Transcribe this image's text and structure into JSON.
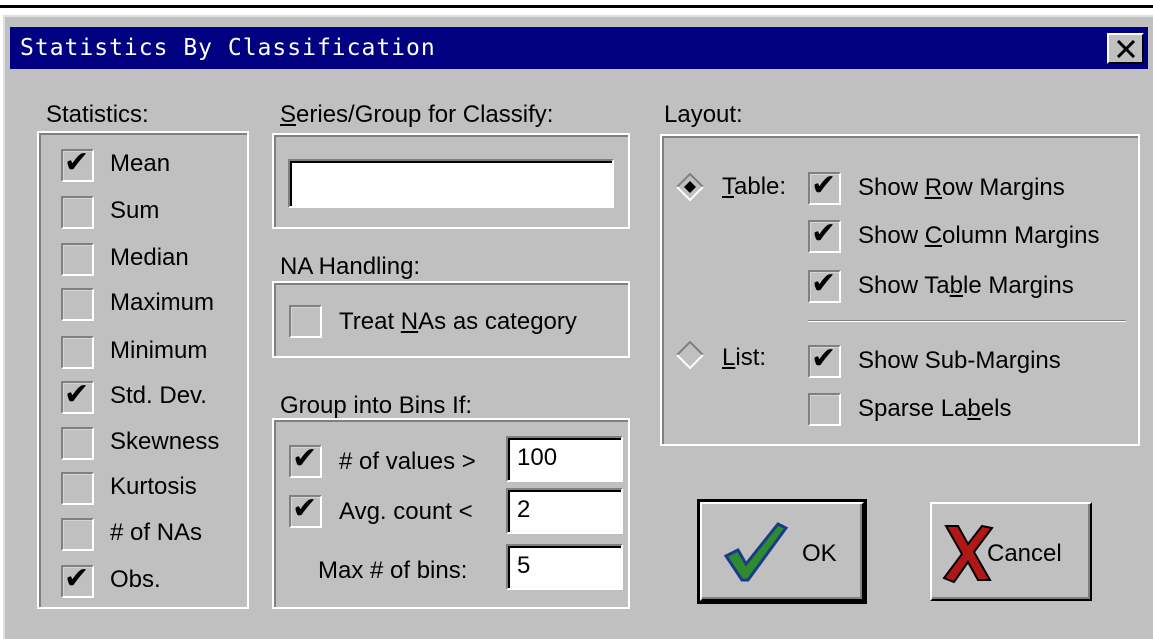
{
  "window": {
    "title": "Statistics By Classification"
  },
  "statistics": {
    "label": "Statistics:",
    "items": [
      {
        "label": "Mean",
        "checked": true
      },
      {
        "label": "Sum",
        "checked": false
      },
      {
        "label": "Median",
        "checked": false
      },
      {
        "label": "Maximum",
        "checked": false
      },
      {
        "label": "Minimum",
        "checked": false
      },
      {
        "label": "Std. Dev.",
        "checked": true
      },
      {
        "label": "Skewness",
        "checked": false
      },
      {
        "label": "Kurtosis",
        "checked": false
      },
      {
        "label": "# of NAs",
        "checked": false
      },
      {
        "label": "Obs.",
        "checked": true
      }
    ]
  },
  "series": {
    "label_prefix": "",
    "label_u": "S",
    "label_rest": "eries/Group for Classify:",
    "value": ""
  },
  "na_handling": {
    "label": "NA Handling:",
    "treat_pre": "Treat ",
    "treat_u": "N",
    "treat_post": "As as category",
    "checked": false
  },
  "bins": {
    "label": "Group into Bins If:",
    "values_label": "# of values >",
    "values_value": "100",
    "values_checked": true,
    "count_label": "Avg. count <",
    "count_value": "2",
    "count_checked": true,
    "max_label": "Max # of bins:",
    "max_value": "5"
  },
  "layout": {
    "label": "Layout:",
    "table_u": "T",
    "table_rest": "able:",
    "table_selected": true,
    "list_u": "L",
    "list_rest": "ist:",
    "list_selected": false,
    "row_pre": "Show ",
    "row_u": "R",
    "row_post": "ow Margins",
    "row_checked": true,
    "col_pre": "Show ",
    "col_u": "C",
    "col_post": "olumn Margins",
    "col_checked": true,
    "tab_pre": "Show Ta",
    "tab_u": "b",
    "tab_post": "le Margins",
    "tab_checked": true,
    "sub_label": "Show Sub-Margins",
    "sub_checked": true,
    "sparse_pre": "Sparse La",
    "sparse_u": "b",
    "sparse_post": "els",
    "sparse_checked": false
  },
  "buttons": {
    "ok": "OK",
    "cancel": "Cancel"
  },
  "colors": {
    "title_bg": "#000080",
    "face": "#c0c0c0",
    "ok_check": "#2e8b2e",
    "cancel_x": "#b01818"
  },
  "icons": {
    "close": "close-icon",
    "ok": "green-check-icon",
    "cancel": "red-x-icon"
  }
}
